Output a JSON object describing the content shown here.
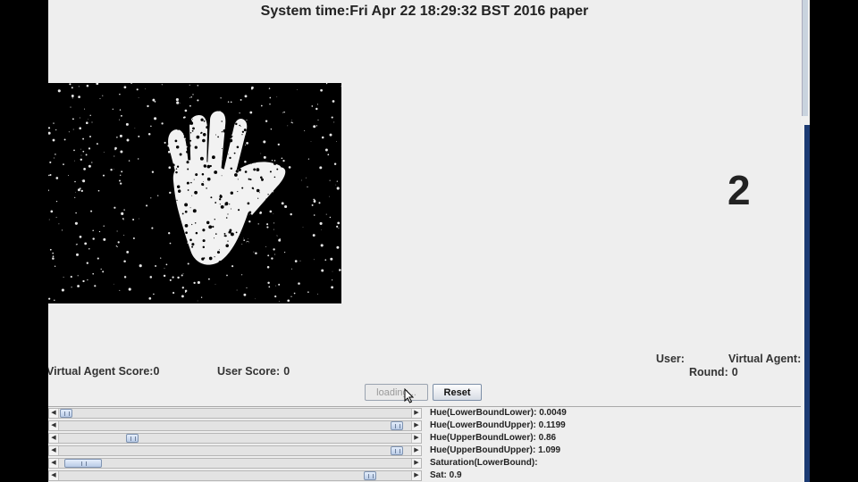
{
  "header": {
    "system_time": "System time:Fri Apr 22 18:29:32 BST 2016 paper"
  },
  "game": {
    "displayed_number": "2",
    "virtual_agent_score_label": "Virtual Agent Score:",
    "virtual_agent_score": "0",
    "user_score_label": "User Score:",
    "user_score": "0",
    "user_label": "User:",
    "virtual_agent_label": "Virtual Agent:",
    "round_label": "Round:",
    "round_value": "0"
  },
  "buttons": {
    "loading_label": "loading...",
    "reset_label": "Reset"
  },
  "sliders": [
    {
      "label": "Hue(LowerBoundLower): 0.0049",
      "position": 0.005
    },
    {
      "label": "Hue(LowerBoundUpper): 0.1199",
      "position": 0.98
    },
    {
      "label": "Hue(UpperBoundLower): 0.86",
      "position": 0.2
    },
    {
      "label": "Hue(UpperBoundUpper): 1.099",
      "position": 0.98
    },
    {
      "label": "Saturation(LowerBound):",
      "position": 0.02
    },
    {
      "label": "Sat: 0.9",
      "position": 0.9
    }
  ],
  "colors": {
    "panel_bg": "#eeeeee",
    "thumb": "#b9cbe6",
    "text": "#222222"
  },
  "icons": {
    "cursor": "mouse-pointer-icon",
    "arrow_left": "arrow-left-icon",
    "arrow_right": "arrow-right-icon"
  }
}
